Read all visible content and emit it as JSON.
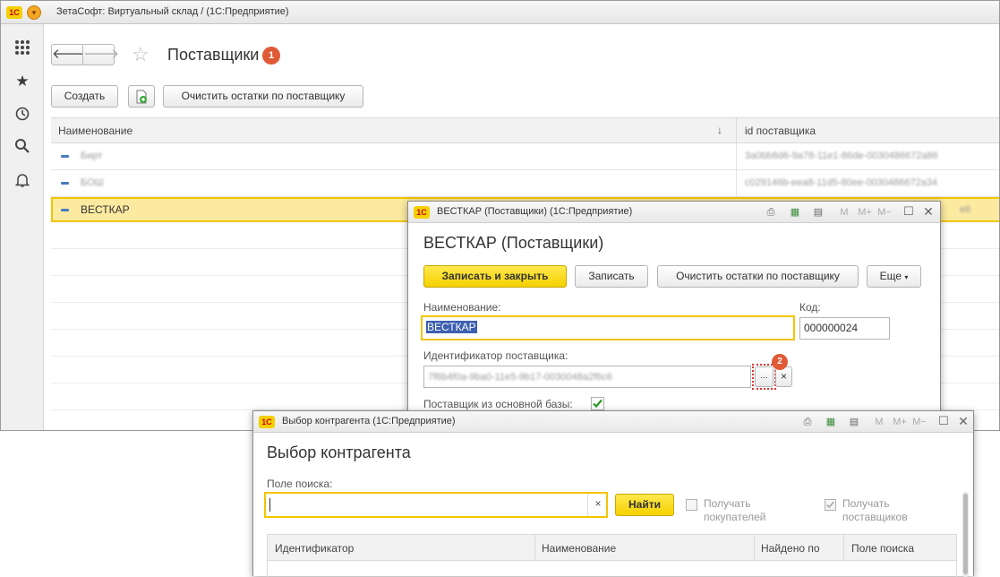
{
  "main": {
    "title": "ЗетаСофт: Виртуальный склад /  (1С:Предприятие)",
    "page_title": "Поставщики",
    "badge1": "1",
    "buttons": {
      "create": "Создать",
      "clear": "Очистить остатки по поставщику"
    },
    "table": {
      "columns": [
        "Наименование",
        "id поставщика"
      ],
      "sort_arrow": "↓",
      "rows": [
        {
          "name": "Бирт",
          "id": "3a0bb8d6-9a78-11e1-86de-0030486672a86"
        },
        {
          "name": "БОШ",
          "id": "c029146b-eea8-11d5-80ee-0030486672a34"
        },
        {
          "name": "ВЕСТКАР",
          "id": "e6"
        }
      ]
    }
  },
  "dialog1": {
    "title": "ВЕСТКАР (Поставщики)  (1С:Предприятие)",
    "heading": "ВЕСТКАР (Поставщики)",
    "buttons": {
      "save_close": "Записать и закрыть",
      "save": "Записать",
      "clear": "Очистить остатки по поставщику",
      "more": "Еще"
    },
    "name_label": "Наименование:",
    "name_value": "ВЕСТКАР",
    "code_label": "Код:",
    "code_value": "000000024",
    "id_label": "Идентификатор поставщика:",
    "id_value": "7f6b4f0a-9ba0-11e5-9b17-0030048a2f6c6",
    "select_btn": "...",
    "clear_x": "×",
    "badge2": "2",
    "main_base_label": "Поставщик из основной базы:",
    "main_base_checked": true
  },
  "dialog2": {
    "title": "Выбор контрагента  (1С:Предприятие)",
    "heading": "Выбор контрагента",
    "search_label": "Поле поиска:",
    "search_value": "",
    "clear_x": "×",
    "find_btn": "Найти",
    "get_buyers": "Получать покупателей",
    "get_suppliers": "Получать поставщиков",
    "columns": [
      "Идентификатор",
      "Наименование",
      "Найдено по",
      "Поле поиска"
    ]
  },
  "toolbar_icons": {
    "m": "M",
    "mplus": "M+",
    "mminus": "M−"
  },
  "colors": {
    "accent": "#f5d000",
    "selected_row": "#fbeaa0",
    "badge": "#e05a36"
  }
}
